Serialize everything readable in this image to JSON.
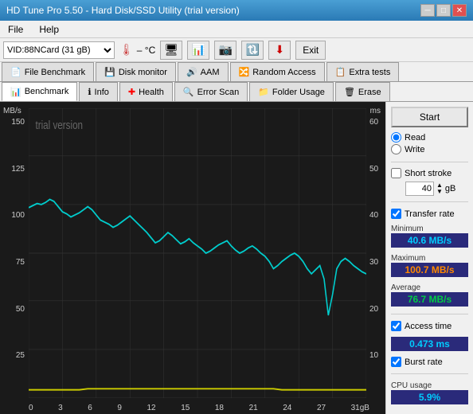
{
  "titlebar": {
    "title": "HD Tune Pro 5.50 - Hard Disk/SSD Utility (trial version)"
  },
  "menubar": {
    "items": [
      "File",
      "Help"
    ]
  },
  "toolbar": {
    "drive": "VID:88NCard (31 gB)",
    "temp": "– °C",
    "exit_label": "Exit"
  },
  "tabs_row1": {
    "tabs": [
      {
        "label": "File Benchmark",
        "icon": "📄"
      },
      {
        "label": "Disk monitor",
        "icon": "💾"
      },
      {
        "label": "AAM",
        "icon": "🔊"
      },
      {
        "label": "Random Access",
        "icon": "🔀"
      },
      {
        "label": "Extra tests",
        "icon": "📋"
      }
    ]
  },
  "tabs_row2": {
    "tabs": [
      {
        "label": "Benchmark",
        "icon": "📊",
        "active": true
      },
      {
        "label": "Info",
        "icon": "ℹ"
      },
      {
        "label": "Health",
        "icon": "➕"
      },
      {
        "label": "Error Scan",
        "icon": "🔍"
      },
      {
        "label": "Folder Usage",
        "icon": "📁"
      },
      {
        "label": "Erase",
        "icon": "🗑"
      }
    ]
  },
  "chart": {
    "watermark": "trial version",
    "y_label_left": "MB/s",
    "y_label_right": "ms",
    "y_left_values": [
      "150",
      "125",
      "100",
      "75",
      "50",
      "25",
      ""
    ],
    "y_right_values": [
      "60",
      "50",
      "40",
      "30",
      "20",
      "10",
      ""
    ],
    "x_values": [
      "0",
      "3",
      "6",
      "9",
      "12",
      "15",
      "18",
      "21",
      "24",
      "27",
      "31gB"
    ]
  },
  "right_panel": {
    "start_label": "Start",
    "read_label": "Read",
    "write_label": "Write",
    "short_stroke_label": "Short stroke",
    "stroke_value": "40",
    "stroke_unit": "gB",
    "transfer_rate_label": "Transfer rate",
    "minimum_label": "Minimum",
    "minimum_value": "40.6 MB/s",
    "maximum_label": "Maximum",
    "maximum_value": "100.7 MB/s",
    "average_label": "Average",
    "average_value": "76.7 MB/s",
    "access_time_label": "Access time",
    "access_time_value": "0.473 ms",
    "burst_rate_label": "Burst rate",
    "cpu_usage_label": "CPU usage",
    "cpu_usage_value": "5.9%"
  }
}
